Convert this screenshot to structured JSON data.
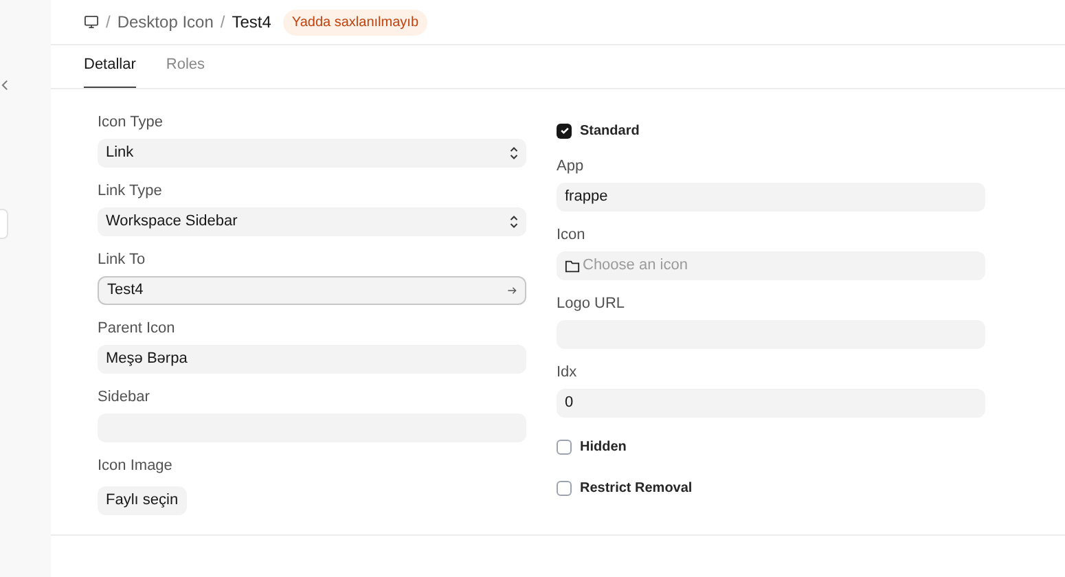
{
  "breadcrumb": {
    "separators": [
      "/",
      "/"
    ],
    "doctype": "Desktop Icon",
    "name": "Test4",
    "status": "Yadda saxlanılmayıb"
  },
  "tabs": [
    {
      "label": "Detallar",
      "selected": true
    },
    {
      "label": "Roles",
      "selected": false
    }
  ],
  "left_fields": [
    {
      "kind": "select",
      "label": "Icon Type",
      "value": "Link"
    },
    {
      "kind": "select",
      "label": "Link Type",
      "value": "Workspace Sidebar"
    },
    {
      "kind": "link",
      "label": "Link To",
      "value": "Test4"
    },
    {
      "kind": "data",
      "label": "Parent Icon",
      "value": "Meşə Bərpa"
    },
    {
      "kind": "data",
      "label": "Sidebar"
    },
    {
      "kind": "attach",
      "label": "Icon Image",
      "value": "Faylı seçin"
    }
  ],
  "right_fields": [
    {
      "kind": "check",
      "label": "Standard",
      "checked": true
    },
    {
      "kind": "data",
      "label": "App",
      "value": "frappe"
    },
    {
      "kind": "icon",
      "label": "Icon",
      "placeholder": "Choose an icon"
    },
    {
      "kind": "data",
      "label": "Logo URL"
    },
    {
      "kind": "data",
      "label": "Idx",
      "value": "0"
    },
    {
      "kind": "check",
      "label": "Hidden",
      "checked": false
    },
    {
      "kind": "check",
      "label": "Restrict Removal",
      "checked": false
    }
  ]
}
